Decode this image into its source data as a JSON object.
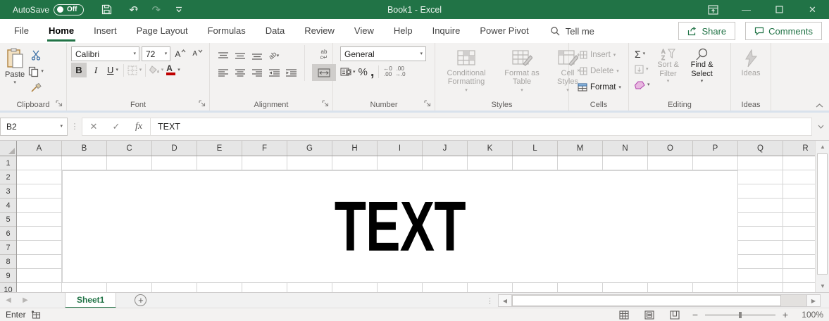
{
  "colors": {
    "accent_green": "#217346",
    "font_color_bar": "#c00000",
    "title_bar": "#217346"
  },
  "titlebar": {
    "autosave_label": "AutoSave",
    "autosave_state": "Off",
    "title": "Book1  -  Excel"
  },
  "ribbon_tabs": {
    "items": [
      {
        "label": "File",
        "active": false
      },
      {
        "label": "Home",
        "active": true
      },
      {
        "label": "Insert",
        "active": false
      },
      {
        "label": "Page Layout",
        "active": false
      },
      {
        "label": "Formulas",
        "active": false
      },
      {
        "label": "Data",
        "active": false
      },
      {
        "label": "Review",
        "active": false
      },
      {
        "label": "View",
        "active": false
      },
      {
        "label": "Help",
        "active": false
      },
      {
        "label": "Inquire",
        "active": false
      },
      {
        "label": "Power Pivot",
        "active": false
      }
    ],
    "tell_me": "Tell me",
    "share": "Share",
    "comments": "Comments"
  },
  "ribbon": {
    "clipboard": {
      "label": "Clipboard",
      "paste": "Paste"
    },
    "font": {
      "label": "Font",
      "font_name": "Calibri",
      "font_size": "72",
      "grow": "A",
      "shrink": "A",
      "bold": "B",
      "italic": "I",
      "underline": "U",
      "color_letter": "A"
    },
    "alignment": {
      "label": "Alignment",
      "wrap_line1": "ab",
      "wrap_line2": "c",
      "orient": "ab"
    },
    "number": {
      "label": "Number",
      "format": "General",
      "percent": "%",
      "comma": ",",
      "inc_top": "←0",
      "inc_bot": ".00",
      "dec_top": ".00",
      "dec_bot": "→.0"
    },
    "styles": {
      "label": "Styles",
      "conditional_formatting": "Conditional Formatting",
      "format_as_table": "Format as Table",
      "cell_styles": "Cell Styles"
    },
    "cells": {
      "label": "Cells",
      "insert": "Insert",
      "delete": "Delete",
      "format": "Format"
    },
    "editing": {
      "label": "Editing",
      "autosum": "Σ",
      "sort_a": "A",
      "sort_z": "Z",
      "sort_filter": "Sort & Filter",
      "find_select": "Find & Select"
    },
    "ideas": {
      "label": "Ideas",
      "button": "Ideas"
    }
  },
  "formula_bar": {
    "name_box": "B2",
    "cancel": "✕",
    "enter": "✓",
    "fx": "fx",
    "formula": "TEXT"
  },
  "grid": {
    "columns": [
      "A",
      "B",
      "C",
      "D",
      "E",
      "F",
      "G",
      "H",
      "I",
      "J",
      "K",
      "L",
      "M",
      "N",
      "O",
      "P",
      "Q",
      "R"
    ],
    "rows": [
      "1",
      "2",
      "3",
      "4",
      "5",
      "6",
      "7",
      "8",
      "9",
      "10"
    ],
    "active_cell": "B2",
    "cell_value": "TEXT"
  },
  "sheet_tabs": {
    "sheet1": "Sheet1"
  },
  "status_bar": {
    "mode": "Enter",
    "zoom": "100%"
  }
}
